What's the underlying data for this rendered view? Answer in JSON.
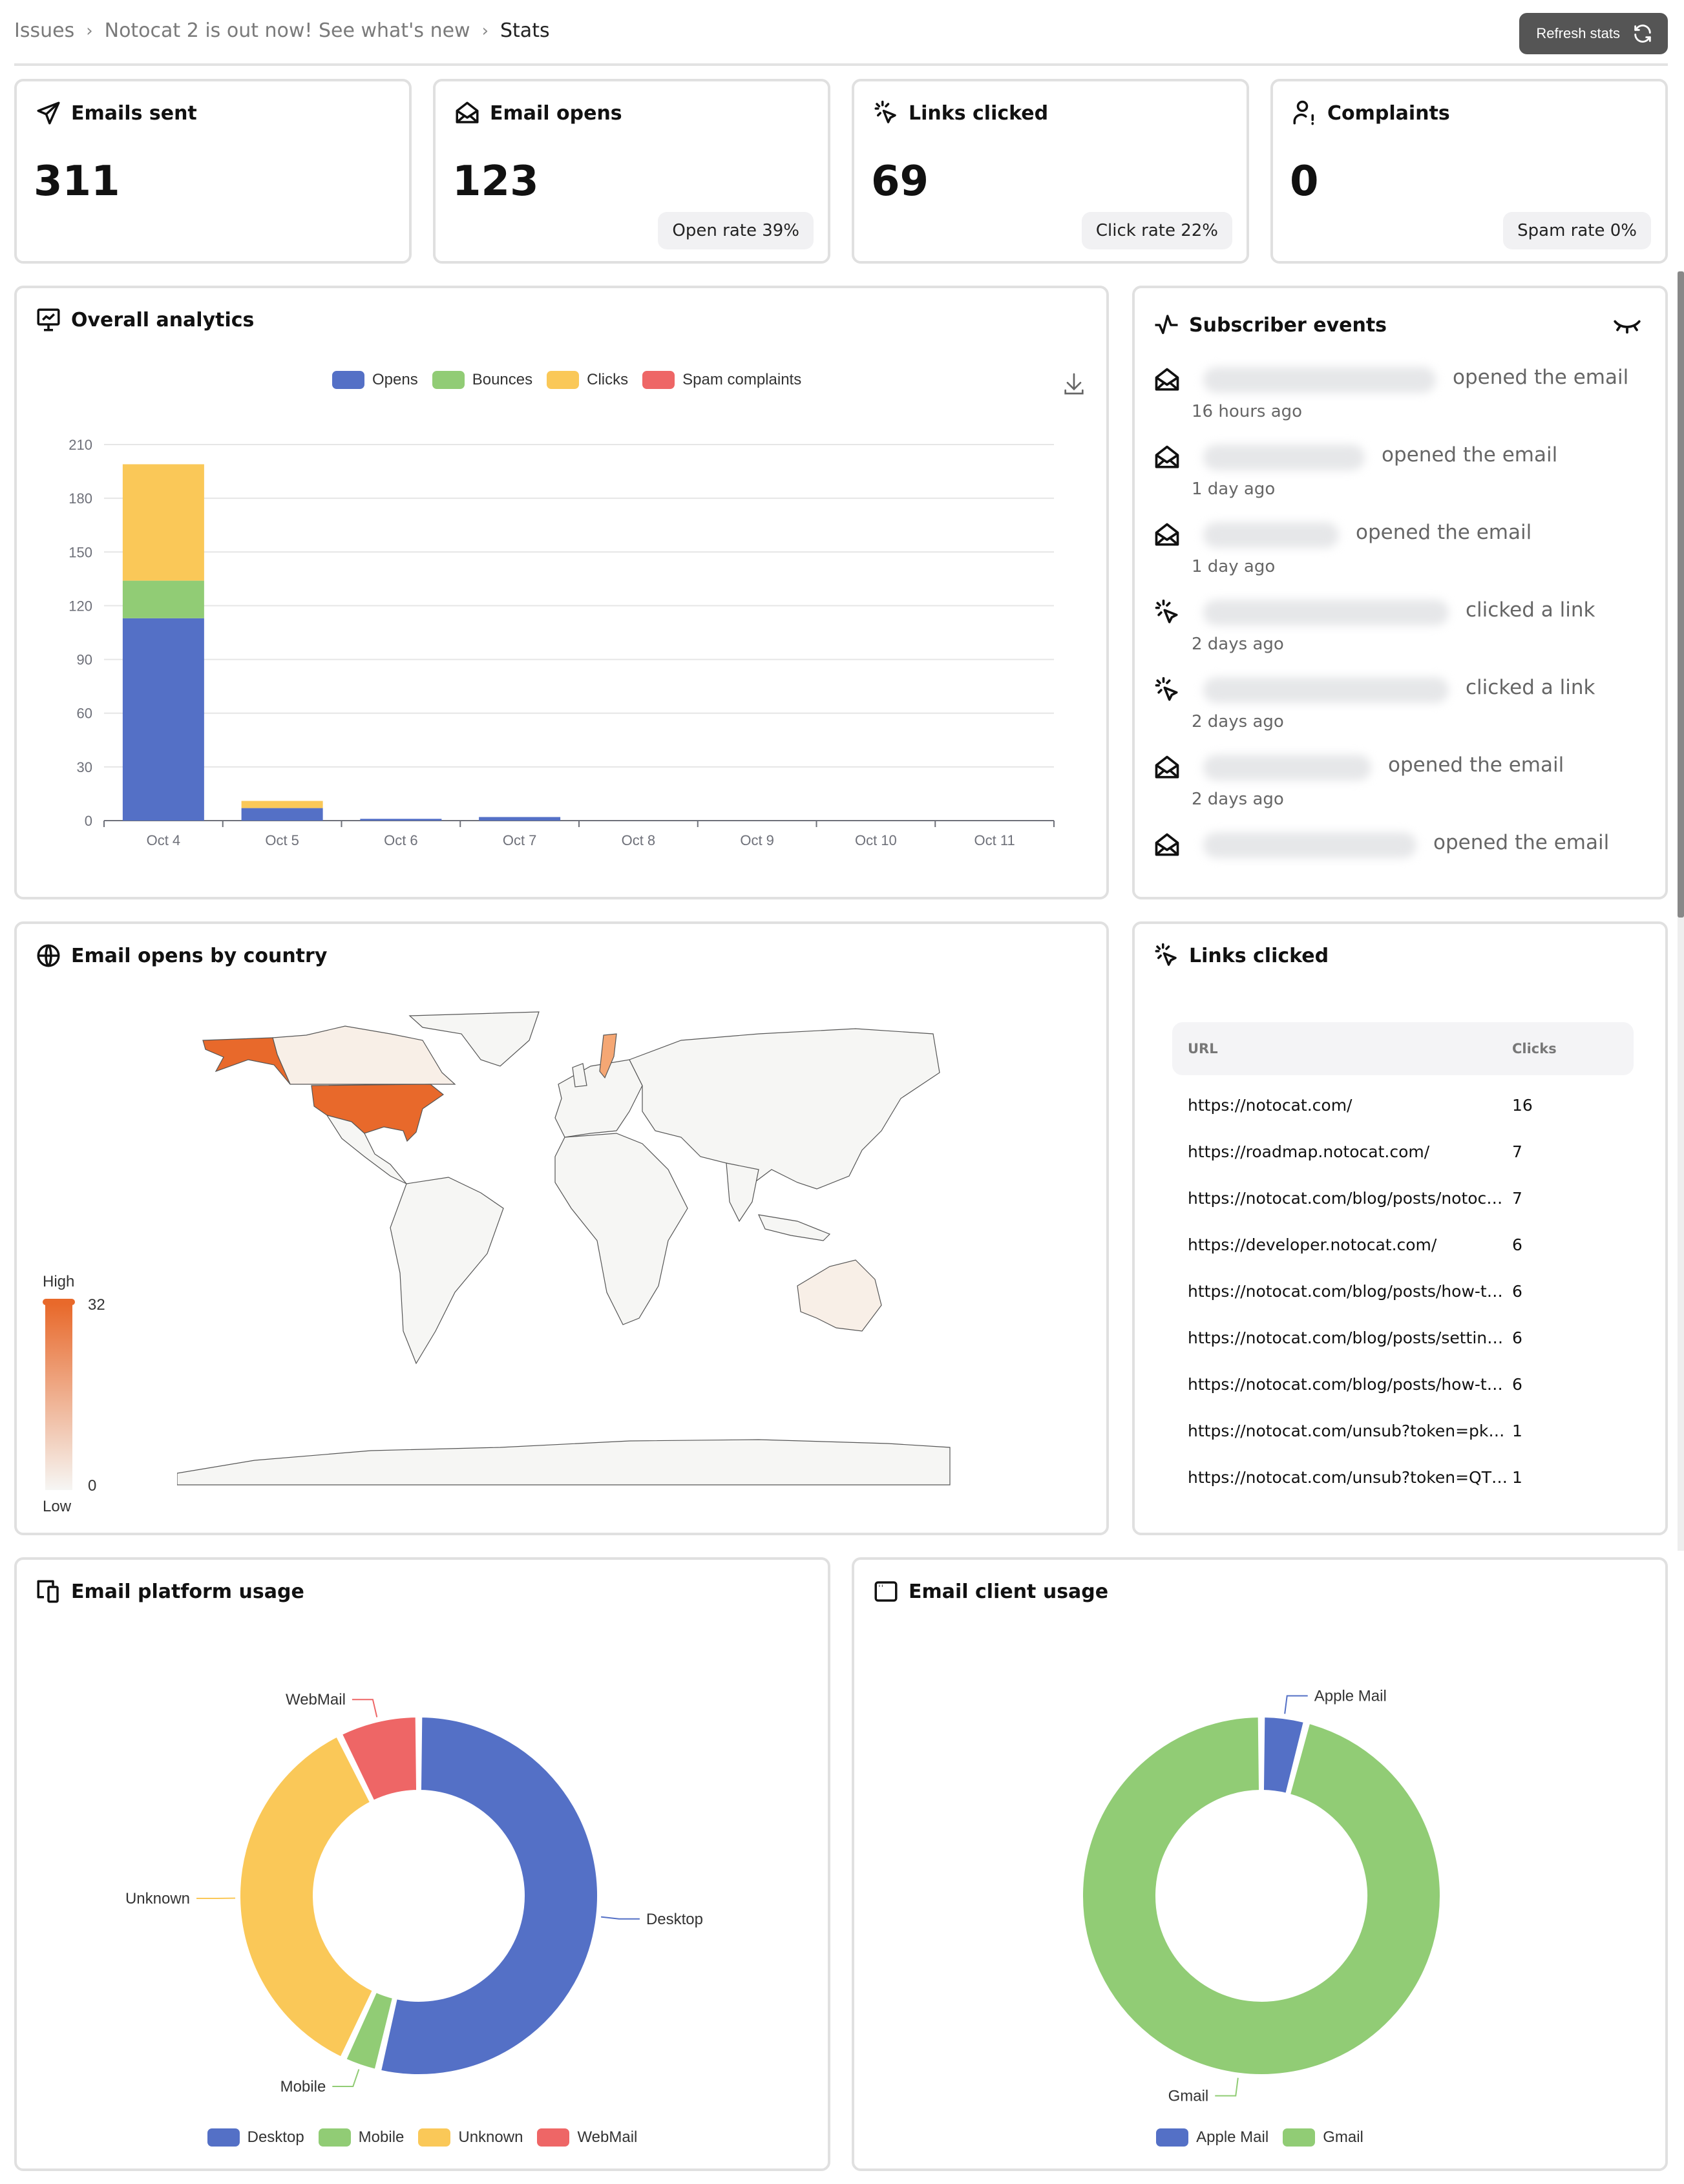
{
  "breadcrumb": {
    "items": [
      "Issues",
      "Notocat 2 is out now! See what's new",
      "Stats"
    ],
    "separator": "›"
  },
  "header": {
    "refresh_label": "Refresh stats",
    "refresh_icon": "refresh-icon"
  },
  "stats": [
    {
      "title": "Emails sent",
      "icon": "paper-plane-icon",
      "value": "311",
      "badge": ""
    },
    {
      "title": "Email opens",
      "icon": "envelope-open-icon",
      "value": "123",
      "badge": "Open rate 39%"
    },
    {
      "title": "Links clicked",
      "icon": "cursor-click-icon",
      "value": "69",
      "badge": "Click rate 22%"
    },
    {
      "title": "Complaints",
      "icon": "user-alert-icon",
      "value": "0",
      "badge": "Spam rate 0%"
    }
  ],
  "overall": {
    "title": "Overall analytics",
    "icon": "presentation-chart-icon",
    "download_icon": "download-icon"
  },
  "subscriber_events": {
    "title": "Subscriber events",
    "icon": "activity-icon",
    "toggle_icon": "eye-closed-icon",
    "items": [
      {
        "icon": "envelope-open-icon",
        "action": "opened the email",
        "time": "16 hours ago"
      },
      {
        "icon": "envelope-open-icon",
        "action": "opened the email",
        "time": "1 day ago"
      },
      {
        "icon": "envelope-open-icon",
        "action": "opened the email",
        "time": "1 day ago"
      },
      {
        "icon": "cursor-click-icon",
        "action": "clicked a link",
        "time": "2 days ago"
      },
      {
        "icon": "cursor-click-icon",
        "action": "clicked a link",
        "time": "2 days ago"
      },
      {
        "icon": "envelope-open-icon",
        "action": "opened the email",
        "time": "2 days ago"
      },
      {
        "icon": "envelope-open-icon",
        "action": "opened the email",
        "time": ""
      }
    ]
  },
  "map": {
    "title": "Email opens by country",
    "icon": "globe-icon",
    "scale_high_label": "High",
    "scale_low_label": "Low",
    "scale_max": "32",
    "scale_min": "0",
    "color_high": "#e8692b",
    "color_low": "#f6f6f4",
    "highlighted": [
      {
        "country": "United States",
        "level": "high"
      },
      {
        "country": "Sweden",
        "level": "medium"
      },
      {
        "country": "Canada",
        "level": "low"
      },
      {
        "country": "Australia",
        "level": "low"
      }
    ]
  },
  "links": {
    "title": "Links clicked",
    "icon": "cursor-click-icon",
    "columns": [
      "URL",
      "Clicks"
    ],
    "rows": [
      {
        "url": "https://notocat.com/",
        "clicks": "16"
      },
      {
        "url": "https://roadmap.notocat.com/",
        "clicks": "7"
      },
      {
        "url": "https://notocat.com/blog/posts/notoc…",
        "clicks": "7"
      },
      {
        "url": "https://developer.notocat.com/",
        "clicks": "6"
      },
      {
        "url": "https://notocat.com/blog/posts/how-t…",
        "clicks": "6"
      },
      {
        "url": "https://notocat.com/blog/posts/settin…",
        "clicks": "6"
      },
      {
        "url": "https://notocat.com/blog/posts/how-t…",
        "clicks": "6"
      },
      {
        "url": "https://notocat.com/unsub?token=pk…",
        "clicks": "1"
      },
      {
        "url": "https://notocat.com/unsub?token=QT…",
        "clicks": "1"
      }
    ]
  },
  "platform": {
    "title": "Email platform usage",
    "icon": "devices-icon"
  },
  "client": {
    "title": "Email client usage",
    "icon": "browser-window-icon"
  },
  "chart_data": [
    {
      "id": "overall",
      "type": "bar",
      "stacked": true,
      "title": "",
      "categories": [
        "Oct 4",
        "Oct 5",
        "Oct 6",
        "Oct 7",
        "Oct 8",
        "Oct 9",
        "Oct 10",
        "Oct 11"
      ],
      "series": [
        {
          "name": "Opens",
          "color": "#5470c6",
          "values": [
            113,
            7,
            1,
            2,
            0,
            0,
            0,
            0
          ]
        },
        {
          "name": "Bounces",
          "color": "#91cc75",
          "values": [
            21,
            0,
            0,
            0,
            0,
            0,
            0,
            0
          ]
        },
        {
          "name": "Clicks",
          "color": "#fac858",
          "values": [
            65,
            4,
            0,
            0,
            0,
            0,
            0,
            0
          ]
        },
        {
          "name": "Spam complaints",
          "color": "#ee6666",
          "values": [
            0,
            0,
            0,
            0,
            0,
            0,
            0,
            0
          ]
        }
      ],
      "yticks": [
        0,
        30,
        60,
        90,
        120,
        150,
        180,
        210
      ],
      "ylim": [
        0,
        210
      ],
      "xlabel": "",
      "ylabel": "",
      "grid": true,
      "legend": "top-center"
    },
    {
      "id": "platform",
      "type": "pie",
      "donut": true,
      "slices": [
        {
          "name": "Desktop",
          "value": 66,
          "color": "#5470c6"
        },
        {
          "name": "Mobile",
          "value": 4,
          "color": "#91cc75"
        },
        {
          "name": "Unknown",
          "value": 44,
          "color": "#fac858"
        },
        {
          "name": "WebMail",
          "value": 9,
          "color": "#ee6666"
        }
      ],
      "legend": "bottom-center"
    },
    {
      "id": "client",
      "type": "pie",
      "donut": true,
      "slices": [
        {
          "name": "Apple Mail",
          "value": 5,
          "color": "#5470c6"
        },
        {
          "name": "Gmail",
          "value": 118,
          "color": "#91cc75"
        }
      ],
      "legend": "bottom-center"
    }
  ]
}
